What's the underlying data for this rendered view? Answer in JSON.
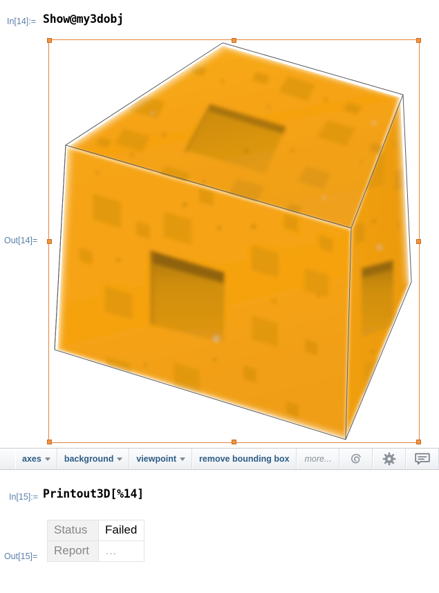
{
  "notebook": {
    "cells": [
      {
        "in_label": "In[14]:=",
        "code": "Show@my3dobj",
        "out_label": "Out[14]="
      },
      {
        "in_label": "In[15]:=",
        "code": "Printout3D[%14]",
        "out_label": "Out[15]="
      }
    ]
  },
  "graphic": {
    "name": "menger-sponge-3d",
    "surface_color": "#f5a211",
    "cavity_color": "#d99410",
    "shadow_color": "#b07a0c",
    "bounding_box_color": "#5a5a5a",
    "background": "#ffffff",
    "selection_color": "#e8833a"
  },
  "toolbar": {
    "buttons": [
      {
        "label": "axes",
        "has_caret": true
      },
      {
        "label": "background",
        "has_caret": true
      },
      {
        "label": "viewpoint",
        "has_caret": true
      },
      {
        "label": "remove bounding box",
        "has_caret": false
      }
    ],
    "more_label": "more...",
    "icons": [
      {
        "name": "wolfram-spikey-curl-icon"
      },
      {
        "name": "gear-icon"
      },
      {
        "name": "comment-bubble-icon"
      }
    ]
  },
  "result_table": {
    "rows": [
      {
        "key": "Status",
        "value": "Failed",
        "muted": false
      },
      {
        "key": "Report",
        "value": "…",
        "muted": true
      }
    ]
  }
}
